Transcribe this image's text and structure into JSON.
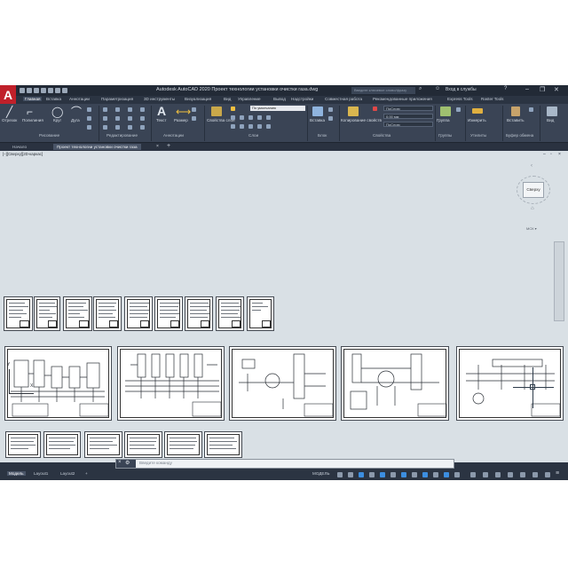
{
  "window": {
    "title": "Autodesk AutoCAD 2020   Проект технологии установки очистки газа.dwg",
    "search_placeholder": "Введите ключевое слово/фразу",
    "sign_in": "Вход в службы",
    "logo": "A"
  },
  "menu_tabs": [
    "Главная",
    "Вставка",
    "Аннотации",
    "Параметризация",
    "3D инструменты",
    "Визуализация",
    "Вид",
    "Управление",
    "Вывод",
    "Надстройки",
    "Совместная работа",
    "Рекомендованные приложения",
    "Express Tools",
    "Raster Tools"
  ],
  "ribbon": {
    "draw": {
      "line": "Отрезок",
      "polyline": "Полилиния",
      "circle": "Круг",
      "arc": "Дуга",
      "panel": "Рисование"
    },
    "modify": {
      "panel": "Редактирование"
    },
    "annotation": {
      "text": "Текст",
      "dimension": "Размер",
      "panel": "Аннотации"
    },
    "layers": {
      "properties": "Свойства слоя",
      "current": "По умолчанию",
      "panel": "Слои"
    },
    "block": {
      "insert": "Вставка",
      "panel": "Блок"
    },
    "properties": {
      "match": "Копирование свойств",
      "color": "ПоСлою",
      "lineweight": "0.00 мм",
      "linetype": "ПоСлою",
      "panel": "Свойства"
    },
    "groups": {
      "group": "Группа",
      "panel": "Группы"
    },
    "utilities": {
      "measure": "Измерить",
      "panel": "Утилиты"
    },
    "clipboard": {
      "paste": "Вставить",
      "panel": "Буфер обмена"
    },
    "view": {
      "base": "Вид"
    }
  },
  "doc_tabs": {
    "start": "Начало",
    "file": "Проект технологии установки очистки газа"
  },
  "viewport": {
    "label": "[–][Сверху][2D-каркас]",
    "cube": "Сверху",
    "wcs": "МСК ▾",
    "ucs_y": "Y",
    "ucs_x": "X"
  },
  "cmdline": {
    "placeholder": "Введите команду"
  },
  "status": {
    "model": "Модель",
    "layout1": "Layout1",
    "layout2": "Layout2",
    "add": "+",
    "mode": "МОДЕЛЬ"
  }
}
